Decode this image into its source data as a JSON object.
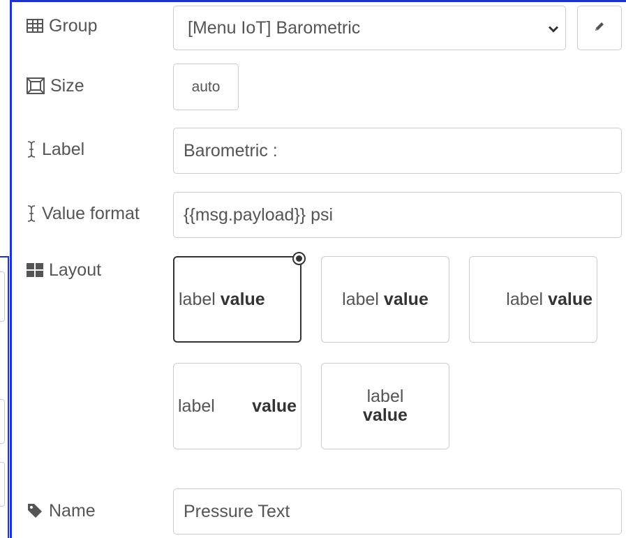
{
  "group": {
    "label": "Group",
    "value": "[Menu IoT] Barometric",
    "icon": "table-icon",
    "edit_icon": "pencil-icon"
  },
  "size": {
    "label": "Size",
    "value": "auto",
    "icon": "size-icon"
  },
  "label_field": {
    "label": "Label",
    "value": "Barometric :",
    "icon": "text-cursor-icon"
  },
  "value_format": {
    "label": "Value format",
    "value": "{{msg.payload}} psi",
    "icon": "text-cursor-icon"
  },
  "layout": {
    "label": "Layout",
    "icon": "grid-icon",
    "selected_index": 0,
    "options": [
      {
        "label": "label",
        "value": "value"
      },
      {
        "label": "label",
        "value": "value"
      },
      {
        "label": "label",
        "value": "value"
      },
      {
        "label": "label",
        "value": "value"
      },
      {
        "label": "label",
        "value": "value"
      }
    ]
  },
  "name": {
    "label": "Name",
    "value": "Pressure Text",
    "icon": "tag-icon"
  },
  "colors": {
    "frame_blue": "#1f33c8",
    "border": "#cccccc",
    "text": "#555555",
    "selected": "#333333"
  }
}
